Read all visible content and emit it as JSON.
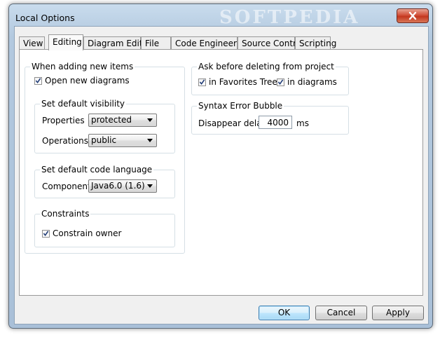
{
  "window": {
    "title": "Local Options",
    "watermark": "SOFTPEDIA"
  },
  "tabs": [
    {
      "label": "View",
      "active": false
    },
    {
      "label": "Editing",
      "active": true
    },
    {
      "label": "Diagram Editing",
      "active": false
    },
    {
      "label": "File",
      "active": false
    },
    {
      "label": "Code Engineering",
      "active": false
    },
    {
      "label": "Source Control",
      "active": false
    },
    {
      "label": "Scripting",
      "active": false
    }
  ],
  "adding_items": {
    "legend": "When adding new items",
    "open_new_diagrams": {
      "label": "Open new diagrams",
      "checked": true
    },
    "visibility": {
      "legend": "Set default visibility",
      "properties_label": "Properties",
      "properties_value": "protected",
      "operations_label": "Operations",
      "operations_value": "public"
    },
    "code_language": {
      "legend": "Set default code language",
      "components_label": "Components",
      "components_value": "Java6.0 (1.6)"
    },
    "constraints": {
      "legend": "Constraints",
      "constrain_owner": {
        "label": "Constrain owner",
        "checked": true
      }
    }
  },
  "ask_before_delete": {
    "legend": "Ask before deleting from project",
    "favorites_tree": {
      "label": "in Favorites Tree",
      "checked": true
    },
    "in_diagrams": {
      "label": "in diagrams",
      "checked": true
    }
  },
  "syntax_bubble": {
    "legend": "Syntax Error Bubble",
    "delay_label": "Disappear delay:",
    "delay_value": "4000",
    "unit": "ms"
  },
  "buttons": {
    "ok": "OK",
    "cancel": "Cancel",
    "apply": "Apply"
  }
}
